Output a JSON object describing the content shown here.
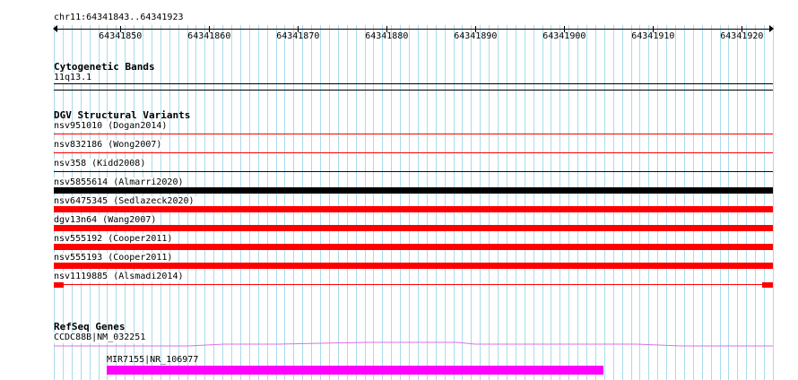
{
  "region": {
    "label": "chr11:64341843..64341923"
  },
  "ruler": {
    "ticks": [
      {
        "pos": 64341850,
        "label": "64341850"
      },
      {
        "pos": 64341860,
        "label": "64341860"
      },
      {
        "pos": 64341870,
        "label": "64341870"
      },
      {
        "pos": 64341880,
        "label": "64341880"
      },
      {
        "pos": 64341890,
        "label": "64341890"
      },
      {
        "pos": 64341900,
        "label": "64341900"
      },
      {
        "pos": 64341910,
        "label": "64341910"
      },
      {
        "pos": 64341920,
        "label": "64341920"
      }
    ],
    "start": 64341843,
    "end": 64341923
  },
  "tracks": {
    "cytogenetic": {
      "title": "Cytogenetic Bands",
      "band_label": "11q13.1",
      "band_color": "#000000"
    },
    "dgv": {
      "title": "DGV Structural Variants",
      "variants": [
        {
          "label": "nsv951010 (Dogan2014)",
          "color": "#ff0000",
          "style": "thin"
        },
        {
          "label": "nsv832186 (Wong2007)",
          "color": "#ff0000",
          "style": "thin"
        },
        {
          "label": "nsv358 (Kidd2008)",
          "color": "#00004d",
          "style": "thin"
        },
        {
          "label": "nsv5855614 (Almarri2020)",
          "color": "#000000",
          "style": "thick"
        },
        {
          "label": "nsv6475345 (Sedlazeck2020)",
          "color": "#ff0000",
          "style": "thick"
        },
        {
          "label": "dgv13n64 (Wang2007)",
          "color": "#ff0000",
          "style": "thick"
        },
        {
          "label": "nsv555192 (Cooper2011)",
          "color": "#ff0000",
          "style": "thick"
        },
        {
          "label": "nsv555193 (Cooper2011)",
          "color": "#ff0000",
          "style": "thick"
        },
        {
          "label": "nsv1119885 (Alsmadi2014)",
          "color": "#ff0000",
          "style": "split"
        }
      ]
    },
    "refseq": {
      "title": "RefSeq Genes",
      "genes": [
        {
          "label": "CCDC88B|NM_032251",
          "color": "#e070e0"
        },
        {
          "label": "MIR7155|NR_106977",
          "color": "#ff00ff"
        }
      ]
    }
  },
  "colors": {
    "grid": "#a8dcec",
    "track_separator": "#000000"
  }
}
